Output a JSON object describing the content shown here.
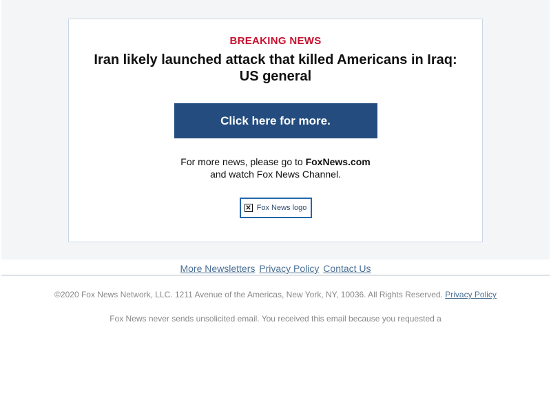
{
  "email": {
    "kicker": "BREAKING NEWS",
    "headline": "Iran likely launched attack that killed Americans in Iraq: US general",
    "cta_label": "Click here for more.",
    "more_news_prefix": "For more news, please go to ",
    "more_news_site": "FoxNews.com",
    "more_news_suffix": "and watch Fox News Channel.",
    "logo_alt": "Fox News logo"
  },
  "footer": {
    "links": [
      "More Newsletters",
      "Privacy Policy",
      "Contact Us"
    ],
    "copyright": "©2020 Fox News Network, LLC. 1211 Avenue of the Americas, New York, NY, 10036. All Rights Reserved.",
    "copyright_link": "Privacy Policy",
    "disclaimer": "Fox News never sends unsolicited email. You received this email because you requested a"
  },
  "colors": {
    "kicker": "#c8102e",
    "cta_bg": "#244c7e",
    "link": "#4a6f94",
    "logo_border": "#2466a8"
  },
  "icons": {
    "logo_placeholder": "broken-image-icon"
  }
}
